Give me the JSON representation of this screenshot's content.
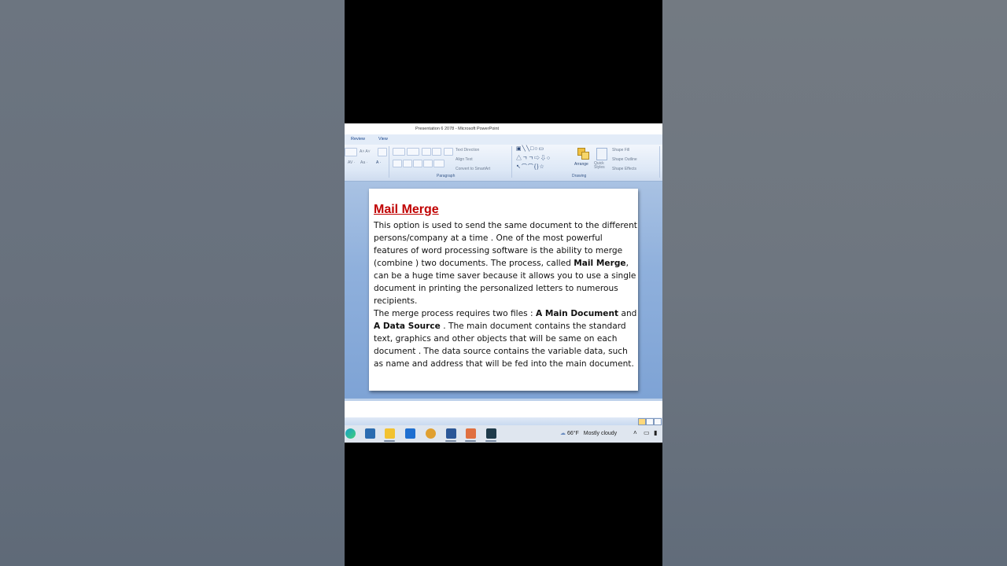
{
  "window": {
    "title": "Presentation 6 2078 - Microsoft PowerPoint"
  },
  "ribbon": {
    "tabs": [
      "Review",
      "View"
    ],
    "groups": {
      "paragraph": "Paragraph",
      "drawing": "Drawing"
    },
    "buttons": {
      "text_direction": "Text Direction",
      "align_text": "Align Text",
      "convert_smartart": "Convert to SmartArt",
      "arrange": "Arrange",
      "quick_styles": "Quick Styles",
      "shape_fill": "Shape Fill",
      "shape_outline": "Shape Outline",
      "shape_effects": "Shape Effects"
    }
  },
  "slide": {
    "title": "Mail Merge",
    "p1_a": "This option is used to send the same document to the different persons/company at a time . One of the most powerful features of word processing software is the ability to merge (combine ) two documents. The process, called ",
    "p1_bold": "Mail Merge",
    "p1_b": ", can be a huge time saver because it allows you to use a single document in printing the personalized letters to numerous recipients.",
    "p2_a": "The merge process requires two files : ",
    "p2_bold1": "A Main Document",
    "p2_b": " and ",
    "p2_bold2": "A Data Source",
    "p2_c": " . The main document contains the standard text, graphics and other objects that will be same on each document . The data source contains the variable data, such as name and address that will be fed into the main document."
  },
  "taskbar": {
    "weather_temp": "66°F",
    "weather_text": "Mostly cloudy",
    "icons": [
      "edge-icon",
      "store-icon",
      "file-explorer-icon",
      "mail-icon",
      "medal-icon",
      "word-icon",
      "powerpoint-icon",
      "app-icon"
    ]
  },
  "colors": {
    "title_red": "#c00000",
    "ribbon_blue": "#dde8f6",
    "slide_bg": "#8fb0dc"
  }
}
